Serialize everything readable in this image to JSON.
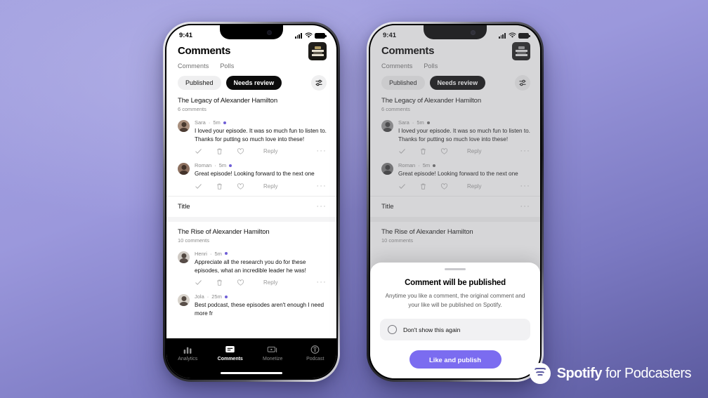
{
  "brand": {
    "name": "Spotify",
    "suffix": " for Podcasters"
  },
  "status_bar": {
    "time": "9:41",
    "signal_icon": "cellular-bars-icon",
    "wifi_icon": "wifi-icon",
    "battery_icon": "battery-full-icon"
  },
  "header": {
    "title": "Comments",
    "album_art_name": "episode-artwork"
  },
  "tabs": [
    {
      "label": "Comments",
      "active": true
    },
    {
      "label": "Polls",
      "active": false
    }
  ],
  "filters": {
    "pills": [
      {
        "label": "Published",
        "active": false
      },
      {
        "label": "Needs review",
        "active": true
      }
    ],
    "filter_icon": "sliders-filter-icon"
  },
  "episodes": [
    {
      "title": "The Legacy of Alexander Hamilton",
      "count": "6 comments",
      "comments": [
        {
          "author": "Sara",
          "time": "5m",
          "unread": true,
          "text": "I loved your episode. It was so much fun to listen to. Thanks for putting so much love into these!",
          "actions": {
            "approve": "check-icon",
            "delete": "trash-icon",
            "like": "heart-icon",
            "reply": "Reply",
            "more": "···"
          }
        },
        {
          "author": "Roman",
          "time": "5m",
          "unread": true,
          "text": "Great episode! Looking forward to the next one",
          "actions": {
            "approve": "check-icon",
            "delete": "trash-icon",
            "like": "heart-icon",
            "reply": "Reply",
            "more": "···"
          }
        }
      ]
    },
    {
      "title": "The Rise of Alexander Hamilton",
      "count": "10 comments",
      "comments": [
        {
          "author": "Henri",
          "time": "5m",
          "unread": true,
          "text": "Appreciate all the research you do for these episodes, what an incredible leader he was!",
          "actions": {
            "approve": "check-icon",
            "delete": "trash-icon",
            "like": "heart-icon",
            "reply": "Reply",
            "more": "···"
          }
        },
        {
          "author": "Jola",
          "time": "25m",
          "unread": true,
          "text": "Best podcast, these episodes aren't enough I need more fr",
          "actions": {
            "approve": "check-icon",
            "delete": "trash-icon",
            "like": "heart-icon",
            "reply": "Reply",
            "more": "···"
          }
        }
      ]
    }
  ],
  "title_row": {
    "label": "Title",
    "more": "···"
  },
  "bottom_nav": [
    {
      "label": "Analytics",
      "icon": "bar-chart-icon",
      "active": false
    },
    {
      "label": "Comments",
      "icon": "comment-bubble-icon",
      "active": true
    },
    {
      "label": "Monetize",
      "icon": "money-icon",
      "active": false
    },
    {
      "label": "Podcast",
      "icon": "microphone-icon",
      "active": false
    }
  ],
  "modal": {
    "title": "Comment will be published",
    "description": "Anytime you like a comment, the original comment and your like will be published on Spotify.",
    "checkbox_label": "Don't show this again",
    "cta_label": "Like and publish",
    "cta_color": "#7b6cf0"
  },
  "colors": {
    "background_top": "#a3a1e0",
    "background_bottom": "#5b5a9e",
    "accent": "#7b6cf0",
    "unread_dot": "#6f5fd6",
    "pill_active_bg": "#0b0b0b",
    "pill_inactive_bg": "#efeff0"
  }
}
